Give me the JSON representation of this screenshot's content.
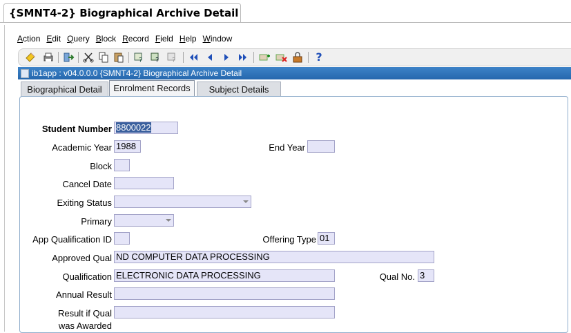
{
  "title_tab": "{SMNT4-2} Biographical Archive Detail",
  "menu": [
    {
      "first": "A",
      "rest": "ction"
    },
    {
      "first": "E",
      "rest": "dit"
    },
    {
      "first": "Q",
      "rest": "uery"
    },
    {
      "first": "B",
      "rest": "lock"
    },
    {
      "first": "R",
      "rest": "ecord"
    },
    {
      "first": "F",
      "rest": "ield"
    },
    {
      "first": "H",
      "rest": "elp"
    },
    {
      "first": "W",
      "rest": "indow"
    }
  ],
  "toolbar_icons": [
    "save-icon",
    "print-icon",
    "exit-icon",
    "cut-icon",
    "copy-icon",
    "paste-icon",
    "enter-query-icon",
    "execute-query-icon",
    "cancel-query-icon",
    "first-record-icon",
    "previous-record-icon",
    "next-record-icon",
    "last-record-icon",
    "insert-record-icon",
    "delete-record-icon",
    "lock-record-icon",
    "help-icon"
  ],
  "window_title": "ib1app : v04.0.0.0  {SMNT4-2} Biographical Archive Detail",
  "tabs": [
    "Biographical Detail",
    "Enrolment Records",
    "Subject Details"
  ],
  "active_tab": "Enrolment Records",
  "form": {
    "student_number": {
      "label": "Student Number",
      "value": "8800022"
    },
    "academic_year": {
      "label": "Academic Year",
      "value": "1988"
    },
    "end_year": {
      "label": "End Year",
      "value": ""
    },
    "block": {
      "label": "Block",
      "value": ""
    },
    "cancel_date": {
      "label": "Cancel Date",
      "value": ""
    },
    "exiting_status": {
      "label": "Exiting Status",
      "value": ""
    },
    "primary": {
      "label": "Primary",
      "value": ""
    },
    "app_qualification_id": {
      "label": "App Qualification ID",
      "value": ""
    },
    "offering_type": {
      "label": "Offering Type",
      "value": "01"
    },
    "approved_qual": {
      "label": "Approved Qual",
      "value": "ND COMPUTER DATA PROCESSING"
    },
    "qualification": {
      "label": "Qualification",
      "value": "ELECTRONIC DATA PROCESSING"
    },
    "qual_no": {
      "label": "Qual No.",
      "value": "3"
    },
    "annual_result": {
      "label": "Annual Result",
      "value": ""
    },
    "result_if_qual_line1": "Result if Qual",
    "result_if_qual_line2": "was Awarded",
    "result_if_qual_value": ""
  },
  "colors": {
    "window_bar": "#2a6db2",
    "field_bg": "#e5e5f8",
    "selection": "#3a5f9d"
  }
}
